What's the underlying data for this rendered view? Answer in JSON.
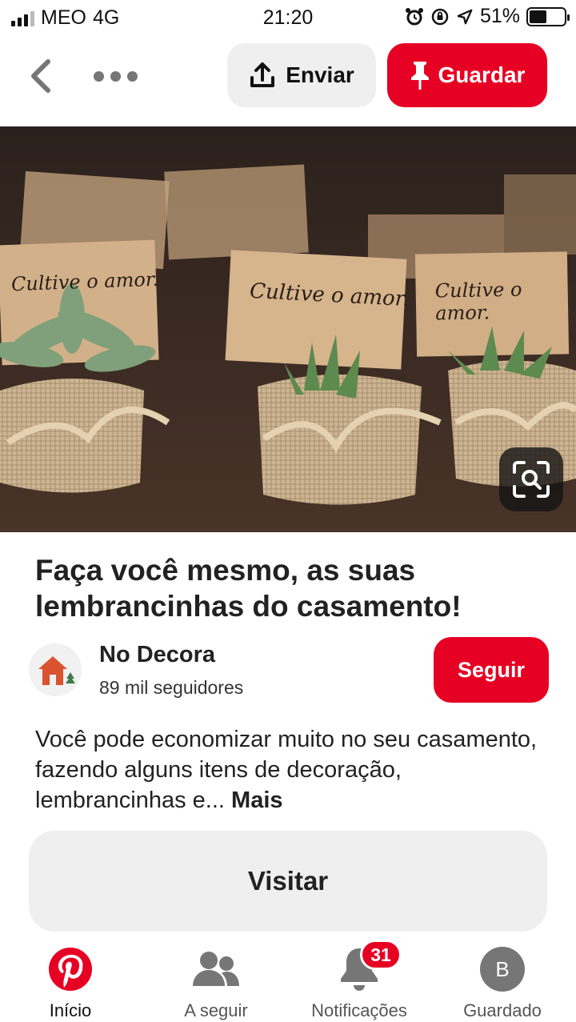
{
  "status_bar": {
    "carrier": "MEO",
    "network": "4G",
    "time": "21:20",
    "battery_percent": "51%",
    "battery_level": 0.51
  },
  "toolbar": {
    "back_icon": "chevron-left-icon",
    "more_icon": "more-horizontal-icon",
    "send_label": "Enviar",
    "save_label": "Guardar"
  },
  "pin": {
    "image_card_texts": [
      "Cultive o amor.",
      "Cultive o amor.",
      "Cultive o amor."
    ],
    "title": "Faça você mesmo, as suas lembrancinhas do casamento!",
    "creator": {
      "name": "No Decora",
      "followers": "89 mil seguidores"
    },
    "follow_label": "Seguir",
    "description": "Você pode economizar muito no seu casamento, fazendo alguns itens de decoração, lembrancinhas e...",
    "more_label": "Mais",
    "visit_label": "Visitar"
  },
  "nav": {
    "items": [
      {
        "label": "Início",
        "icon": "pinterest-logo-icon"
      },
      {
        "label": "A seguir",
        "icon": "people-icon"
      },
      {
        "label": "Notificações",
        "icon": "bell-icon",
        "badge": "31"
      },
      {
        "label": "Guardado",
        "icon": "avatar",
        "avatar_letter": "B"
      }
    ]
  },
  "colors": {
    "brand_red": "#e60023",
    "button_gray": "#efefef"
  }
}
